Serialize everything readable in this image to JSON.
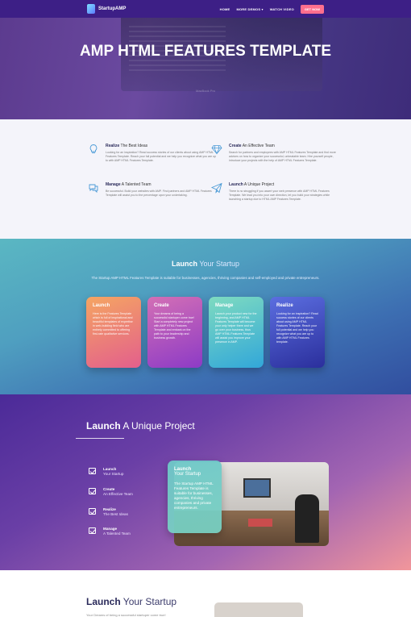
{
  "nav": {
    "logo_text": "StartupAMP",
    "links": [
      "HOME",
      "MORE DEMOS ▾",
      "WATCH VIDEO"
    ],
    "cta": "GET NOW"
  },
  "hero": {
    "title": "AMP HTML FEATURES TEMPLATE",
    "screen_caption": "MacBook Pro"
  },
  "features": [
    {
      "bold": "Realize",
      "rest": " The Best Ideas",
      "body": "Looking for an inspiration? Read success stories of our clients about using AMP HTML Features Template. Reach your full potential and we help you recognize what you are up to with AMP HTML Features Template.",
      "icon": "lightbulb-icon"
    },
    {
      "bold": "Create",
      "rest": " An Effective Team",
      "body": "Search for partners and employees with AMP HTML Features Template and find more advices on how to organize your successful, unbeatable team. Hire yourself people, introduce your projects with the help of AMP HTML Features Template.",
      "icon": "diamond-icon"
    },
    {
      "bold": "Manage",
      "rest": " A Talented Team",
      "body": "Be successful. Build your websites with AMP. Find partners and AMP HTML Features Template will assist you to the percentage upon your undertaking.",
      "icon": "chat-icon"
    },
    {
      "bold": "Launch",
      "rest": " A Unique Project",
      "body": "There is no struggling if you assert your web presence with AMP HTML Features Template. We lead you into your own direction, let you build your strategies while launching a startup due to HTML AMP Features Template.",
      "icon": "paper-plane-icon"
    }
  ],
  "launch": {
    "title_bold": "Launch",
    "title_rest": " Your Startup",
    "text": "The Startup AMP HTML Features Template is suitable for businesses, agencies, thriving companies and self-employed and private entrepreneurs.",
    "cards": [
      {
        "title": "Launch",
        "body": "Here is the Features Template which is full of inspirational and beautiful templates of expertise in web-building field who are entirely committed to offering first-rate qualitative services.",
        "color_from": "#f5a562",
        "color_to": "#e35f8c"
      },
      {
        "title": "Create",
        "body": "Your dreams of being a successful startuper come true! Start a completely new project with AMP HTML Features Template and embark on the path to your leadership and business growth.",
        "color_from": "#d36fb5",
        "color_to": "#8d3bc6"
      },
      {
        "title": "Manage",
        "body": "Launch your product new for the beginning, and AMP HTML Features Template will become your only helper there and we go over your business, thus AMP HTML Features Template will assist you improve your presence in AMP.",
        "color_from": "#7edbc0",
        "color_to": "#32a7d9"
      },
      {
        "title": "Realize",
        "body": "Looking for an inspiration? Read success stories of our clients about using AMP HTML Features Template. Reach your full potential and we help you recognize what you are up to with AMP HTML Features template.",
        "color_from": "#5b6ee0",
        "color_to": "#2b2f9c"
      }
    ]
  },
  "unique": {
    "title_bold": "Launch",
    "title_rest": " A Unique Project",
    "items": [
      {
        "title": "Launch",
        "sub": "Your Startup"
      },
      {
        "title": "Create",
        "sub": "An Effective Team"
      },
      {
        "title": "Realize",
        "sub": "The Best Ideas"
      },
      {
        "title": "Manage",
        "sub": "A Talented Team"
      }
    ],
    "card": {
      "title": "Launch",
      "sub": "Your Startup",
      "body": "The Startup AMP HTML Features Template is suitable for businesses, agencies, thriving companies and private entrepreneurs."
    }
  },
  "bottom": {
    "title_bold": "Launch",
    "title_rest": " Your Startup",
    "text": "Your Dreams of being a successful startuper come true!"
  }
}
